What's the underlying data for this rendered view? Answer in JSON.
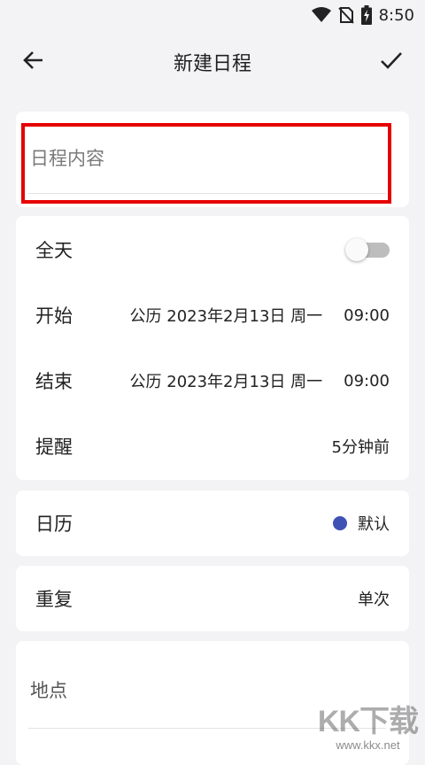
{
  "status_bar": {
    "time": "8:50"
  },
  "app_bar": {
    "title": "新建日程",
    "back_icon": "arrow-left-icon",
    "confirm_icon": "check-icon"
  },
  "content": {
    "placeholder": "日程内容"
  },
  "time_settings": {
    "all_day_label": "全天",
    "all_day_enabled": false,
    "start_label": "开始",
    "start_date": "公历 2023年2月13日 周一",
    "start_time": "09:00",
    "end_label": "结束",
    "end_date": "公历 2023年2月13日 周一",
    "end_time": "09:00",
    "reminder_label": "提醒",
    "reminder_value": "5分钟前"
  },
  "calendar": {
    "label": "日历",
    "value": "默认",
    "color": "#3f51b5"
  },
  "repeat": {
    "label": "重复",
    "value": "单次"
  },
  "location": {
    "label": "地点"
  },
  "watermark": {
    "main": "KK下载",
    "sub": "www.kkx.net"
  },
  "colors": {
    "highlight": "#e60000",
    "background": "#f3f3f5"
  }
}
